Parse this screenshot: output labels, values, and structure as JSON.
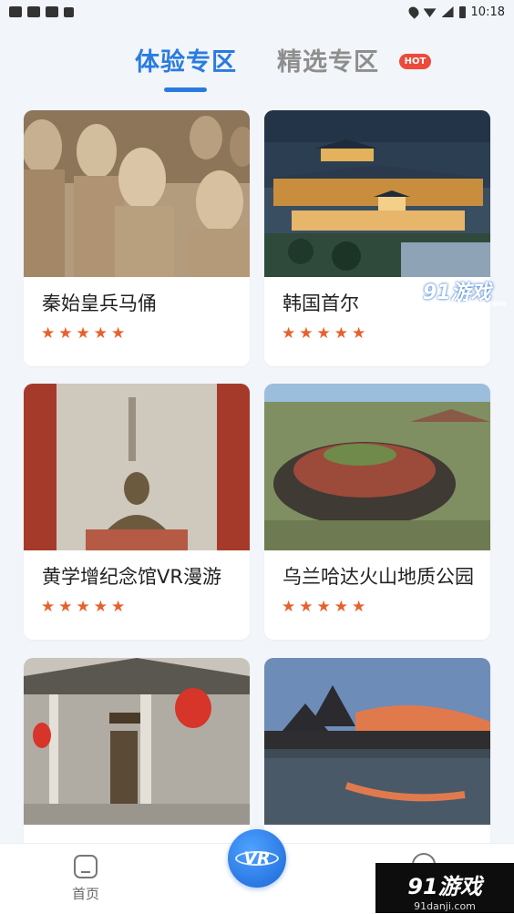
{
  "status_bar": {
    "time": "10:18"
  },
  "tabs": [
    {
      "label": "体验专区",
      "active": true
    },
    {
      "label": "精选专区",
      "active": false,
      "badge": "HOT"
    }
  ],
  "cards": [
    {
      "title": "秦始皇兵马俑",
      "rating": 5,
      "image": "terracotta-warriors"
    },
    {
      "title": "韩国首尔",
      "rating": 5,
      "image": "seoul-palace-night"
    },
    {
      "title": "黄学增纪念馆VR漫游",
      "rating": 5,
      "image": "memorial-bust"
    },
    {
      "title": "乌兰哈达火山地质公园",
      "rating": 5,
      "image": "volcano-crater"
    },
    {
      "title": "",
      "rating": 0,
      "image": "chinese-ancestral-hall"
    },
    {
      "title": "",
      "rating": 0,
      "image": "ancient-town-lake"
    }
  ],
  "bottom_nav": {
    "home_label": "首页",
    "vr_label": "VR"
  },
  "watermarks": {
    "top_main": "91游戏",
    "top_sub": "91danji.com",
    "bottom_main": "91游戏",
    "bottom_sub": "91danji.com"
  },
  "colors": {
    "accent": "#2a7be0",
    "star": "#e8602c",
    "hot_badge": "#ec4a3b"
  }
}
